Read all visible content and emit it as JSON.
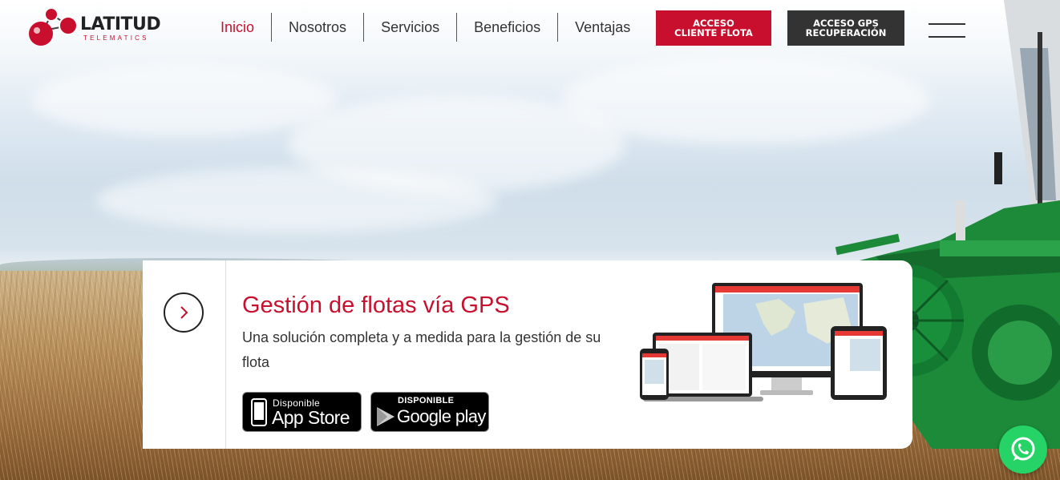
{
  "logo": {
    "name": "LATITUD",
    "sub": "TELEMATICS"
  },
  "nav": {
    "items": [
      {
        "label": "Inicio"
      },
      {
        "label": "Nosotros"
      },
      {
        "label": "Servicios"
      },
      {
        "label": "Beneficios"
      },
      {
        "label": "Ventajas"
      }
    ]
  },
  "header_buttons": {
    "fleet_line1": "ACCESO",
    "fleet_line2": "CLIENTE FLOTA",
    "gps_line1": "ACCESO GPS",
    "gps_line2": "RECUPERACIÓN"
  },
  "hero": {
    "title": "Gestión de flotas vía GPS",
    "description": "Una solución completa y a medida para la gestión de su flota"
  },
  "stores": {
    "apple_small": "Disponible",
    "apple_big": "App Store",
    "google_small": "DISPONIBLE",
    "google_big": "Google play"
  },
  "colors": {
    "brand_red": "#c8102e",
    "dark": "#333333",
    "whatsapp": "#25d366"
  },
  "icons": [
    "hamburger-menu-icon",
    "chevron-right-icon",
    "apple-icon",
    "google-play-icon",
    "whatsapp-icon"
  ]
}
